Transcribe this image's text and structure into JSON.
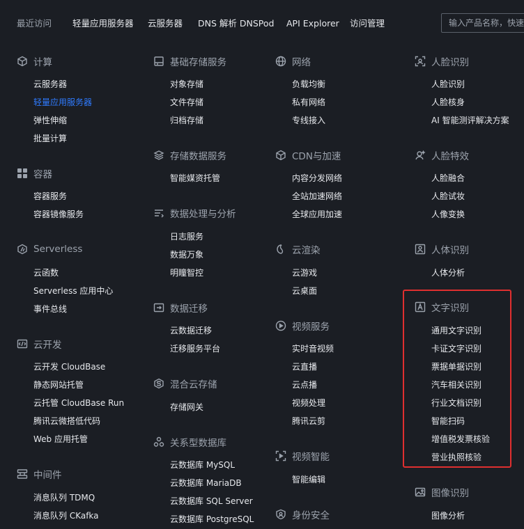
{
  "top_nav": {
    "recent_label": "最近访问",
    "items": [
      "轻量应用服务器",
      "云服务器",
      "DNS 解析 DNSPod",
      "API Explorer",
      "访问管理"
    ],
    "search_placeholder": "输入产品名称，快速"
  },
  "columns": [
    [
      {
        "title": "计算",
        "icon": "cube-icon",
        "items": [
          "云服务器",
          "轻量应用服务器",
          "弹性伸缩",
          "批量计算"
        ],
        "active_index": 1
      },
      {
        "title": "容器",
        "icon": "container-icon",
        "items": [
          "容器服务",
          "容器镜像服务"
        ]
      },
      {
        "title": "Serverless",
        "icon": "serverless-icon",
        "items": [
          "云函数",
          "Serverless 应用中心",
          "事件总线"
        ]
      },
      {
        "title": "云开发",
        "icon": "code-icon",
        "items": [
          "云开发 CloudBase",
          "静态网站托管",
          "云托管 CloudBase Run",
          "腾讯云微搭低代码",
          "Web 应用托管"
        ]
      },
      {
        "title": "中间件",
        "icon": "middleware-icon",
        "items": [
          "消息队列 TDMQ",
          "消息队列 CKafka"
        ]
      }
    ],
    [
      {
        "title": "基础存储服务",
        "icon": "storage-icon",
        "items": [
          "对象存储",
          "文件存储",
          "归档存储"
        ]
      },
      {
        "title": "存储数据服务",
        "icon": "layers-icon",
        "items": [
          "智能媒资托管"
        ]
      },
      {
        "title": "数据处理与分析",
        "icon": "data-process-icon",
        "items": [
          "日志服务",
          "数据万象",
          "明瞳智控"
        ]
      },
      {
        "title": "数据迁移",
        "icon": "migrate-icon",
        "items": [
          "云数据迁移",
          "迁移服务平台"
        ]
      },
      {
        "title": "混合云存储",
        "icon": "hybrid-storage-icon",
        "items": [
          "存储网关"
        ]
      },
      {
        "title": "关系型数据库",
        "icon": "database-icon",
        "items": [
          "云数据库 MySQL",
          "云数据库 MariaDB",
          "云数据库 SQL Server",
          "云数据库 PostgreSQL"
        ]
      }
    ],
    [
      {
        "title": "网络",
        "icon": "globe-icon",
        "items": [
          "负载均衡",
          "私有网络",
          "专线接入"
        ]
      },
      {
        "title": "CDN与加速",
        "icon": "cdn-icon",
        "items": [
          "内容分发网络",
          "全站加速网络",
          "全球应用加速"
        ]
      },
      {
        "title": "云渲染",
        "icon": "render-icon",
        "items": [
          "云游戏",
          "云桌面"
        ]
      },
      {
        "title": "视频服务",
        "icon": "play-icon",
        "items": [
          "实时音视频",
          "云直播",
          "云点播",
          "视频处理",
          "腾讯云剪"
        ]
      },
      {
        "title": "视频智能",
        "icon": "video-ai-icon",
        "items": [
          "智能编辑"
        ]
      },
      {
        "title": "身份安全",
        "icon": "shield-icon",
        "items": []
      }
    ],
    [
      {
        "title": "人脸识别",
        "icon": "face-scan-icon",
        "items": [
          "人脸识别",
          "人脸核身",
          "AI 智能测评解决方案"
        ]
      },
      {
        "title": "人脸特效",
        "icon": "face-effect-icon",
        "items": [
          "人脸融合",
          "人脸试妆",
          "人像变换"
        ]
      },
      {
        "title": "人体识别",
        "icon": "body-scan-icon",
        "items": [
          "人体分析"
        ]
      },
      {
        "title": "文字识别",
        "icon": "text-ocr-icon",
        "items": [
          "通用文字识别",
          "卡证文字识别",
          "票据单据识别",
          "汽车相关识别",
          "行业文档识别",
          "智能扫码",
          "增值税发票核验",
          "营业执照核验"
        ],
        "highlighted": true
      },
      {
        "title": "图像识别",
        "icon": "image-icon",
        "items": [
          "图像分析"
        ]
      }
    ]
  ],
  "colors": {
    "background": "#1b1e24",
    "text": "#e6e8ec",
    "muted": "#9ca3ad",
    "active": "#2f7bff",
    "highlight": "#e02f2f"
  }
}
